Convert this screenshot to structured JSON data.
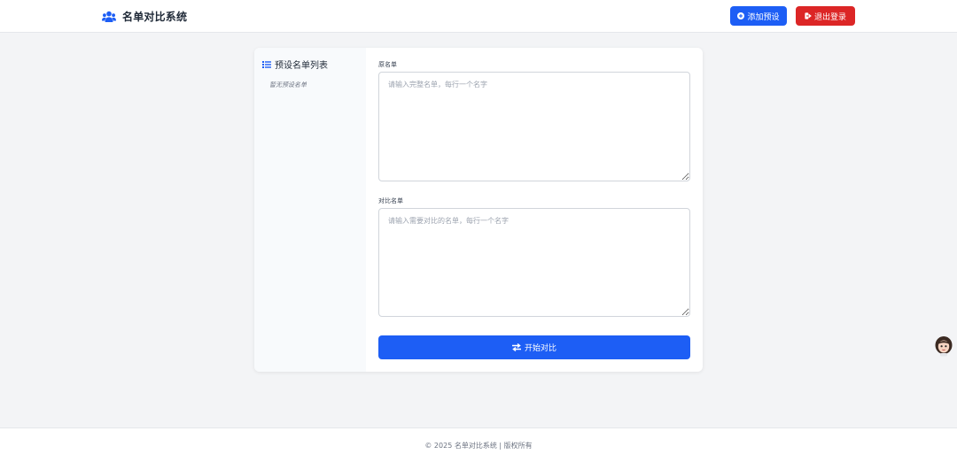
{
  "header": {
    "brand_icon": "users-icon",
    "title": "名单对比系统",
    "add_preset_label": "添加预设",
    "logout_label": "退出登录",
    "colors": {
      "primary": "#1d5ef5",
      "danger": "#dc2626"
    }
  },
  "sidebar": {
    "title": "预设名单列表",
    "empty_text": "暂无预设名单"
  },
  "form": {
    "original_label": "原名单",
    "original_placeholder": "请输入完整名单，每行一个名字",
    "original_value": "",
    "compare_label": "对比名单",
    "compare_placeholder": "请输入需要对比的名单，每行一个名字",
    "compare_value": "",
    "submit_label": "开始对比",
    "submit_icon": "exchange-icon"
  },
  "footer": {
    "text": "© 2025 名单对比系统 | 版权所有"
  }
}
